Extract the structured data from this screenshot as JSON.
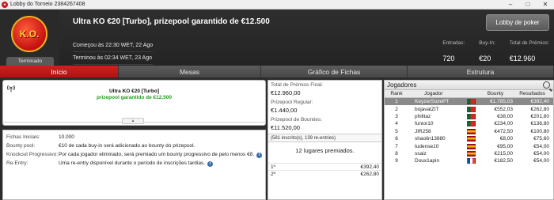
{
  "window": {
    "title": "Lobby do Torneio 2384267408",
    "minimize": "–",
    "maximize": "□",
    "close": "✕"
  },
  "header": {
    "logo_text": "K.O.",
    "status": "Terminado",
    "tournament_name": "Ultra KO €20 [Turbo], prizepool garantido de €12.500",
    "lobby_button": "Lobby de poker",
    "started": "Começou às 22:30 WET, 22 Ago",
    "finished": "Terminou às 02:34 WET, 23 Ago",
    "stats": [
      {
        "label": "Entradas:",
        "value": "720"
      },
      {
        "label": "Buy-In:",
        "value": "€20"
      },
      {
        "label": "Total de Prémios:",
        "value": "€12.960"
      }
    ]
  },
  "tabs": [
    {
      "label": "Início",
      "active": true
    },
    {
      "label": "Mesas",
      "active": false
    },
    {
      "label": "Gráfico de Fichas",
      "active": false
    },
    {
      "label": "Estrutura",
      "active": false
    }
  ],
  "info_box": {
    "name": "Ultra KO €20 [Turbo]",
    "subtitle": "prizepool garantido de €12.500",
    "icon": "broadcast-icon"
  },
  "details": [
    {
      "key": "Fichas Iniciais:",
      "value": "10.000",
      "info": false
    },
    {
      "key": "Bounty pool:",
      "value": "€10 de cada buy-in será adicionado ao bounty do prizepool.",
      "info": false
    },
    {
      "key": "Knockout Progressivo:",
      "value": "Por cada jogador eliminado, será premiado um bounty progressivo de pelo menos €8.",
      "info": true
    },
    {
      "key": "Re-Entry:",
      "value": "Uma re-entry disponível durante o período de inscrições tardias.",
      "info": true
    }
  ],
  "prize": {
    "total_label": "Total de Prémios Final:",
    "total_value": "€12.960,00",
    "regular_label": "Prizepool Regular:",
    "regular_value": "€1.440,00",
    "bounties_label": "Prizepool de Bounties:",
    "bounties_value": "€11.520,00",
    "entries_note": "(581 inscrito(s), 139 re-entries)",
    "places_paid": "12 lugares premiados.",
    "payouts": [
      {
        "pos": "1º",
        "amount": "€392,40"
      },
      {
        "pos": "2º",
        "amount": "€262,80"
      }
    ]
  },
  "players": {
    "title": "Jogadores",
    "columns": {
      "rank": "Rank",
      "player": "Jogador",
      "bounty": "Bounty",
      "results": "Resultados"
    },
    "rows": [
      {
        "rank": "1",
        "name": "KeyzerSozePT",
        "flag": "portugal",
        "bounty": "€1.785,03",
        "result": "€392,40",
        "selected": true
      },
      {
        "rank": "2",
        "name": "bojavatZIT",
        "flag": "portugal",
        "bounty": "€552,03",
        "result": "€262,80",
        "selected": false
      },
      {
        "rank": "3",
        "name": "philitaz",
        "flag": "portugal",
        "bounty": "€38,00",
        "result": "€201,60",
        "selected": false
      },
      {
        "rank": "4",
        "name": "funior10",
        "flag": "portugal",
        "bounty": "€234,00",
        "result": "€136,80",
        "selected": false
      },
      {
        "rank": "5",
        "name": "JIR258",
        "flag": "spain",
        "bounty": "€472,50",
        "result": "€100,80",
        "selected": false
      },
      {
        "rank": "6",
        "name": "shaolin13880",
        "flag": "spain",
        "bounty": "€8,00",
        "result": "€75,60",
        "selected": false
      },
      {
        "rank": "7",
        "name": "tudense10",
        "flag": "spain",
        "bounty": "€95,00",
        "result": "€54,00",
        "selected": false
      },
      {
        "rank": "8",
        "name": "ssaiz",
        "flag": "spain",
        "bounty": "€215,00",
        "result": "€54,00",
        "selected": false
      },
      {
        "rank": "9",
        "name": "Doux1apin",
        "flag": "france",
        "bounty": "€182,50",
        "result": "€54,00",
        "selected": false
      }
    ]
  },
  "colors": {
    "accent_red": "#c8171e",
    "header_bg": "#262626",
    "guarantee_green": "#1a9e1a",
    "selected_row": "#8a8a8a"
  }
}
